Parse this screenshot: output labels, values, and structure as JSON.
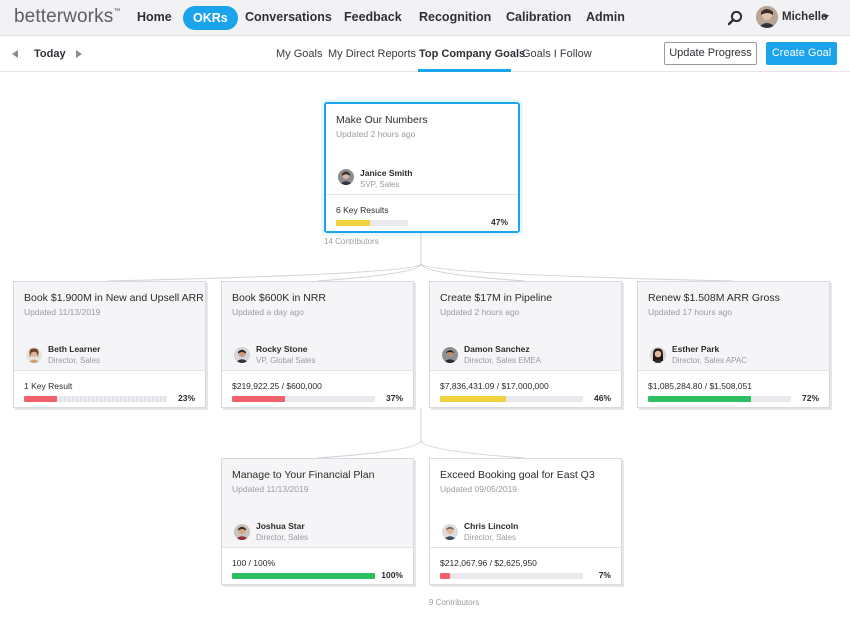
{
  "app": {
    "logo": "betterworks",
    "nav": [
      "Home",
      "OKRs",
      "Conversations",
      "Feedback",
      "Recognition",
      "Calibration",
      "Admin"
    ],
    "active_nav": "OKRs",
    "user_name": "Michelle"
  },
  "subnav": {
    "date_label": "Today",
    "tabs": [
      "My Goals",
      "My Direct Reports",
      "Top Company Goals",
      "Goals I Follow"
    ],
    "active_tab": "Top Company Goals",
    "update_button": "Update Progress",
    "create_button": "Create Goal"
  },
  "colors": {
    "accent": "#1ba3ec",
    "progress_low": "#f0616b",
    "progress_mid": "#f0d33f",
    "progress_high": "#2fbf63"
  },
  "goals": {
    "root": {
      "title": "Make Our Numbers",
      "updated": "Updated 2 hours ago",
      "owner": "Janice Smith",
      "role": "SVP, Sales",
      "kr_label": "6 Key Results",
      "progress": 47,
      "progress_label": "47%",
      "status": "mid",
      "contributors": "14 Contributors"
    },
    "children": [
      {
        "title": "Book $1.900M in New and Upsell ARR",
        "updated": "Updated 11/13/2019",
        "owner": "Beth Learner",
        "role": "Director, Sales",
        "kr_label": "1 Key Result",
        "progress": 23,
        "progress_label": "23%",
        "status": "low"
      },
      {
        "title": "Book $600K in NRR",
        "updated": "Updated a day ago",
        "owner": "Rocky Stone",
        "role": "VP, Global Sales",
        "kr_label": "$219,922.25 / $600,000",
        "progress": 37,
        "progress_label": "37%",
        "status": "low"
      },
      {
        "title": "Create $17M in Pipeline",
        "updated": "Updated 2 hours ago",
        "owner": "Damon Sanchez",
        "role": "Director, Sales EMEA",
        "kr_label": "$7,836,431.09 / $17,000,000",
        "progress": 46,
        "progress_label": "46%",
        "status": "mid"
      },
      {
        "title": "Renew $1.508M ARR Gross",
        "updated": "Updated 17 hours ago",
        "owner": "Esther Park",
        "role": "Director, Sales APAC",
        "kr_label": "$1,085,284.80 / $1,508,051",
        "progress": 72,
        "progress_label": "72%",
        "status": "high"
      }
    ],
    "grandchildren": [
      {
        "title": "Manage to Your Financial Plan",
        "updated": "Updated 11/13/2019",
        "owner": "Joshua Star",
        "role": "Director, Sales",
        "kr_label": "100 / 100%",
        "progress": 100,
        "progress_label": "100%",
        "status": "high"
      },
      {
        "title": "Exceed Booking goal for East Q3",
        "updated": "Updated 09/05/2019",
        "owner": "Chris Lincoln",
        "role": "Director, Sales",
        "kr_label": "$212,067.96 / $2,625,950",
        "progress": 7,
        "progress_label": "7%",
        "status": "low"
      }
    ],
    "grandchildren_contributors": "9 Contributors"
  }
}
